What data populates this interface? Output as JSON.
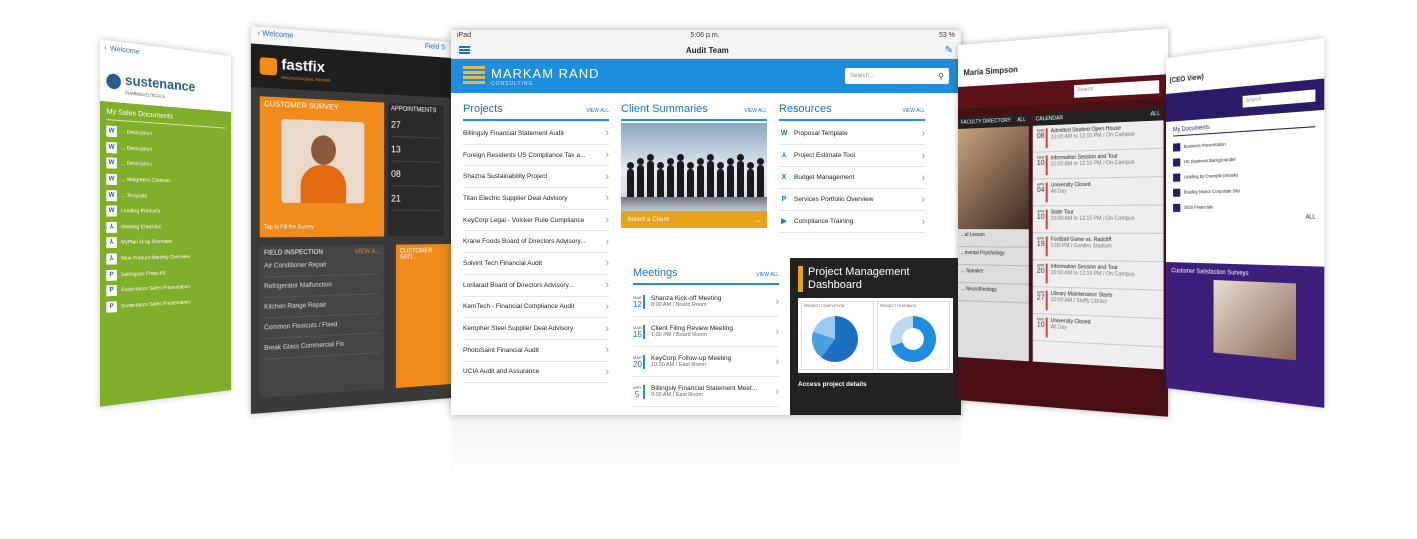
{
  "tablet_far_left": {
    "back": "Welcome",
    "brand": "sustenance",
    "brand_sub": "PHARMACEUTICALS",
    "section": "My Sales Documents",
    "items": [
      "... Description",
      "... Description",
      "... Description",
      "... Walgreens Contract",
      "... Template",
      "Leading Products",
      "Meeting Checklist",
      "MyPlan Drug Overview",
      "New Product Monthly Overview",
      "Sellingups Press Kit",
      "Sustenance Sales Presentation",
      "Sustenance Sales Presentation"
    ]
  },
  "tablet_left": {
    "back": "Welcome",
    "brand": "fastfix",
    "brand_sub": "PROFESSIONAL REPAIR",
    "survey_title": "CUSTOMER SURVEY",
    "survey_cta": "Tap to Fill the Survey",
    "appointments": "APPOINTMENTS",
    "appt_days": [
      "27",
      "13",
      "08",
      "21"
    ],
    "field_title": "FIELD INSPECTION",
    "field_view": "VIEW A...",
    "field_items": [
      "Air Conditioner Repair",
      "Refrigerator Malfunction",
      "Kitchen Range Repair",
      "Common Flexicuts / Fixed",
      "Break Glass Commercial Fix"
    ],
    "satisfaction": "CUSTOMER SATI..."
  },
  "main": {
    "status": {
      "device": "iPad",
      "time": "5:06 p.m.",
      "battery": "53 %"
    },
    "nav_title": "Audit Team",
    "brand_name": "MARKAM RAND",
    "brand_sub": "CONSULTING",
    "search_placeholder": "Search...",
    "projects": {
      "heading": "Projects",
      "view_all": "VIEW ALL",
      "items": [
        "Billingsly Financial Statement Audit",
        "Foreign Residents US Compliance Tax a...",
        "Shazna Sustainability Project",
        "Titan Electric Supplier Deal Advisory",
        "KeyCorp Legal - Volcker Rule Compliance",
        "Krane Foods Board of Directors Advisory...",
        "Solvint Tech Financial Audit",
        "Lorilarad Board of Directors Advisory...",
        "KemTech - Financial Compliance Audit",
        "Kempher Steel Supplier Deal Advisory",
        "PhotoSaint Financial Audit",
        "UCIA Audit and Assurance"
      ]
    },
    "client_summaries": {
      "heading": "Client Summaries",
      "view_all": "VIEW ALL",
      "select_label": "Select a Client"
    },
    "resources": {
      "heading": "Resources",
      "view_all": "VIEW ALL",
      "items": [
        {
          "icon": "W",
          "icon_name": "word-icon",
          "label": "Proposal Template"
        },
        {
          "icon": "⅄",
          "icon_name": "pdf-icon",
          "label": "Project Estimate Tool"
        },
        {
          "icon": "X",
          "icon_name": "excel-icon",
          "label": "Budget Management"
        },
        {
          "icon": "P",
          "icon_name": "powerpoint-icon",
          "label": "Services Portfolio Overview"
        },
        {
          "icon": "▶",
          "icon_name": "video-icon",
          "label": "Compliance Training"
        }
      ]
    },
    "meetings": {
      "heading": "Meetings",
      "view_all": "VIEW ALL",
      "items": [
        {
          "month": "MAR",
          "day": "12",
          "title": "Shanza Kick-off Meeting",
          "detail": "8:00 AM / Board Room"
        },
        {
          "month": "MAR",
          "day": "15",
          "title": "Client Filing Review Meeting",
          "detail": "1:00 PM / Board Room"
        },
        {
          "month": "MAR",
          "day": "20",
          "title": "KeyCorp Follow-up Meeting",
          "detail": "10:30 AM / East Room"
        },
        {
          "month": "APR",
          "day": "5",
          "title": "Billingsly Financial Statement Meet...",
          "detail": "9:00 AM / East Room"
        }
      ]
    },
    "dashboard": {
      "title": "Project Management Dashboard",
      "chart1_title": "PROJECT COMPLETION",
      "chart2_title": "PROJECT FEEDBACK",
      "cta": "Access project details"
    }
  },
  "tablet_right": {
    "user": "Maria Simpson",
    "search_placeholder": "Search",
    "directory": "FACULTY DIRECTORY",
    "calendar": "CALENDAR",
    "all": "ALL",
    "dir_items": [
      "...al Lesson",
      "...mental Psychology",
      "... Speaker",
      "... Neurotheology"
    ],
    "events": [
      {
        "month": "MAR",
        "day": "08",
        "title": "Admitted Student Open House",
        "detail": "10:00 AM to 12:15 PM / On Campus"
      },
      {
        "month": "MAR",
        "day": "10",
        "title": "Information Session and Tour",
        "detail": "10:00 AM to 12:15 PM / On Campus"
      },
      {
        "month": "APR",
        "day": "04",
        "title": "University Closed",
        "detail": "All Day"
      },
      {
        "month": "APR",
        "day": "10",
        "title": "State Tour",
        "detail": "10:00 AM to 12:15 PM / On Campus"
      },
      {
        "month": "APR",
        "day": "19",
        "title": "Football Game vs. Radcliff",
        "detail": "1:00 PM / Garden Stadium"
      },
      {
        "month": "APR",
        "day": "20",
        "title": "Information Session and Tour",
        "detail": "10:00 AM to 12:15 PM / On Campus"
      },
      {
        "month": "APR",
        "day": "27",
        "title": "Library Maintenance Starts",
        "detail": "10:00 AM / Stuffy Library"
      },
      {
        "month": "MAY",
        "day": "10",
        "title": "University Closed",
        "detail": "All Day"
      }
    ]
  },
  "tablet_far_right": {
    "title": "(CEO View)",
    "search_placeholder": "Search",
    "docs_heading": "My Documents",
    "docs": [
      "Business Presentation",
      "HC Business Backgrounder",
      "Leading by Example (ebook)",
      "Bradley Manor Corporate Site",
      "2016 Financials"
    ],
    "all": "ALL",
    "survey": "Customer Satisfaction Surveys"
  }
}
